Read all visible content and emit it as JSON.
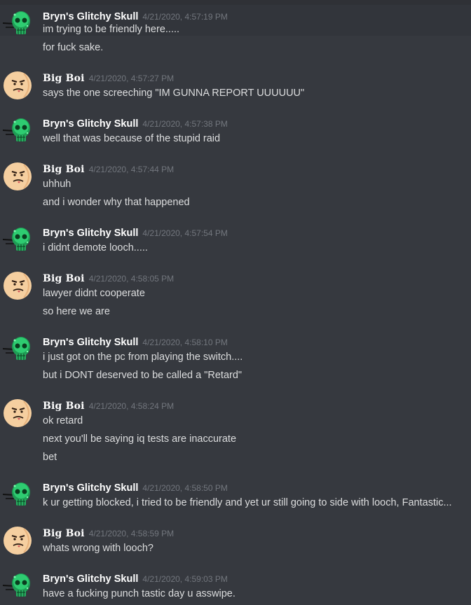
{
  "users": {
    "bryn": {
      "name": "Bryn's Glitchy Skull",
      "avatar_icon": "green-skull-avatar"
    },
    "boi": {
      "name": "Big Boi",
      "avatar_icon": "cartoon-face-avatar"
    }
  },
  "messages": [
    {
      "author": "Bryn's Glitchy Skull",
      "timestamp": "4/21/2020, 4:57:19 PM",
      "lines": [
        "im trying to be friendly here.....",
        "for fuck sake."
      ]
    },
    {
      "author": "Big Boi",
      "timestamp": "4/21/2020, 4:57:27 PM",
      "lines": [
        "says the one screeching \"IM GUNNA REPORT UUUUUU\""
      ]
    },
    {
      "author": "Bryn's Glitchy Skull",
      "timestamp": "4/21/2020, 4:57:38 PM",
      "lines": [
        "well that was because of the stupid raid"
      ]
    },
    {
      "author": "Big Boi",
      "timestamp": "4/21/2020, 4:57:44 PM",
      "lines": [
        "uhhuh",
        "and i wonder why that happened"
      ]
    },
    {
      "author": "Bryn's Glitchy Skull",
      "timestamp": "4/21/2020, 4:57:54 PM",
      "lines": [
        "i didnt demote looch....."
      ]
    },
    {
      "author": "Big Boi",
      "timestamp": "4/21/2020, 4:58:05 PM",
      "lines": [
        "lawyer didnt cooperate",
        "so here we are"
      ]
    },
    {
      "author": "Bryn's Glitchy Skull",
      "timestamp": "4/21/2020, 4:58:10 PM",
      "lines": [
        "i just got on the pc from playing the switch....",
        "but i DONT deserved to be called a \"Retard\""
      ]
    },
    {
      "author": "Big Boi",
      "timestamp": "4/21/2020, 4:58:24 PM",
      "lines": [
        "ok retard",
        "next you'll be saying iq tests are inaccurate",
        "bet"
      ]
    },
    {
      "author": "Bryn's Glitchy Skull",
      "timestamp": "4/21/2020, 4:58:50 PM",
      "lines": [
        "k ur getting blocked, i tried to be friendly and yet ur still going to side with looch, Fantastic..."
      ]
    },
    {
      "author": "Big Boi",
      "timestamp": "4/21/2020, 4:58:59 PM",
      "lines": [
        "whats wrong with looch?"
      ]
    },
    {
      "author": "Bryn's Glitchy Skull",
      "timestamp": "4/21/2020, 4:59:03 PM",
      "lines": [
        "have a fucking punch tastic day u asswipe."
      ]
    }
  ],
  "colors": {
    "background": "#36393f",
    "author_name": "#ffffff",
    "timestamp": "#72767d",
    "message_text": "#dcddde",
    "skull_green": "#2ecc71"
  }
}
